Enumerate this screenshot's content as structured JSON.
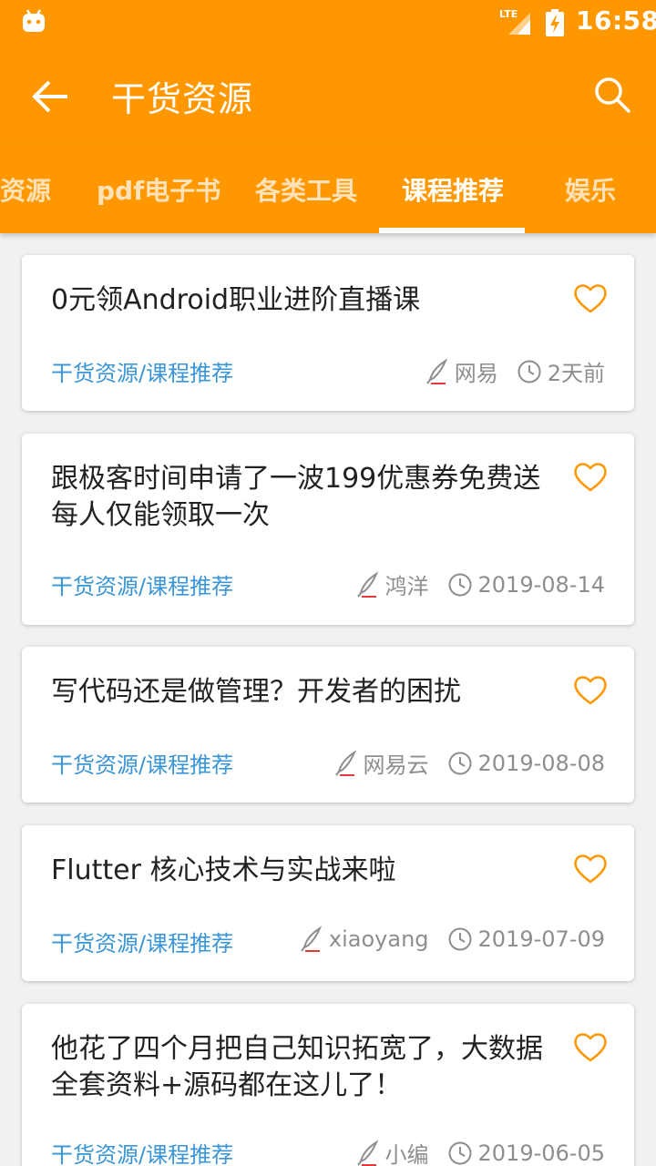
{
  "status_bar": {
    "time": "16:58",
    "network": "LTE"
  },
  "header": {
    "title": "干货资源"
  },
  "tabs": [
    {
      "label": "资源"
    },
    {
      "label": "pdf电子书"
    },
    {
      "label": "各类工具"
    },
    {
      "label": "课程推荐"
    },
    {
      "label": "娱乐"
    }
  ],
  "active_tab": "课程推荐",
  "colors": {
    "primary": "#ff9800",
    "category_link": "#3a95d6",
    "favorite": "#ff9800"
  },
  "articles": [
    {
      "title": "0元领Android职业进阶直播课",
      "category": "干货资源/课程推荐",
      "author": "网易",
      "date": "2天前"
    },
    {
      "title": "跟极客时间申请了一波199优惠券免费送 每人仅能领取一次",
      "category": "干货资源/课程推荐",
      "author": "鸿洋",
      "date": "2019-08-14"
    },
    {
      "title": "写代码还是做管理？开发者的困扰",
      "category": "干货资源/课程推荐",
      "author": "网易云",
      "date": "2019-08-08"
    },
    {
      "title": "Flutter 核心技术与实战来啦",
      "category": "干货资源/课程推荐",
      "author": "xiaoyang",
      "date": "2019-07-09"
    },
    {
      "title": "他花了四个月把自己知识拓宽了，大数据全套资料+源码都在这儿了！",
      "category": "干货资源/课程推荐",
      "author": "小编",
      "date": "2019-06-05"
    }
  ]
}
